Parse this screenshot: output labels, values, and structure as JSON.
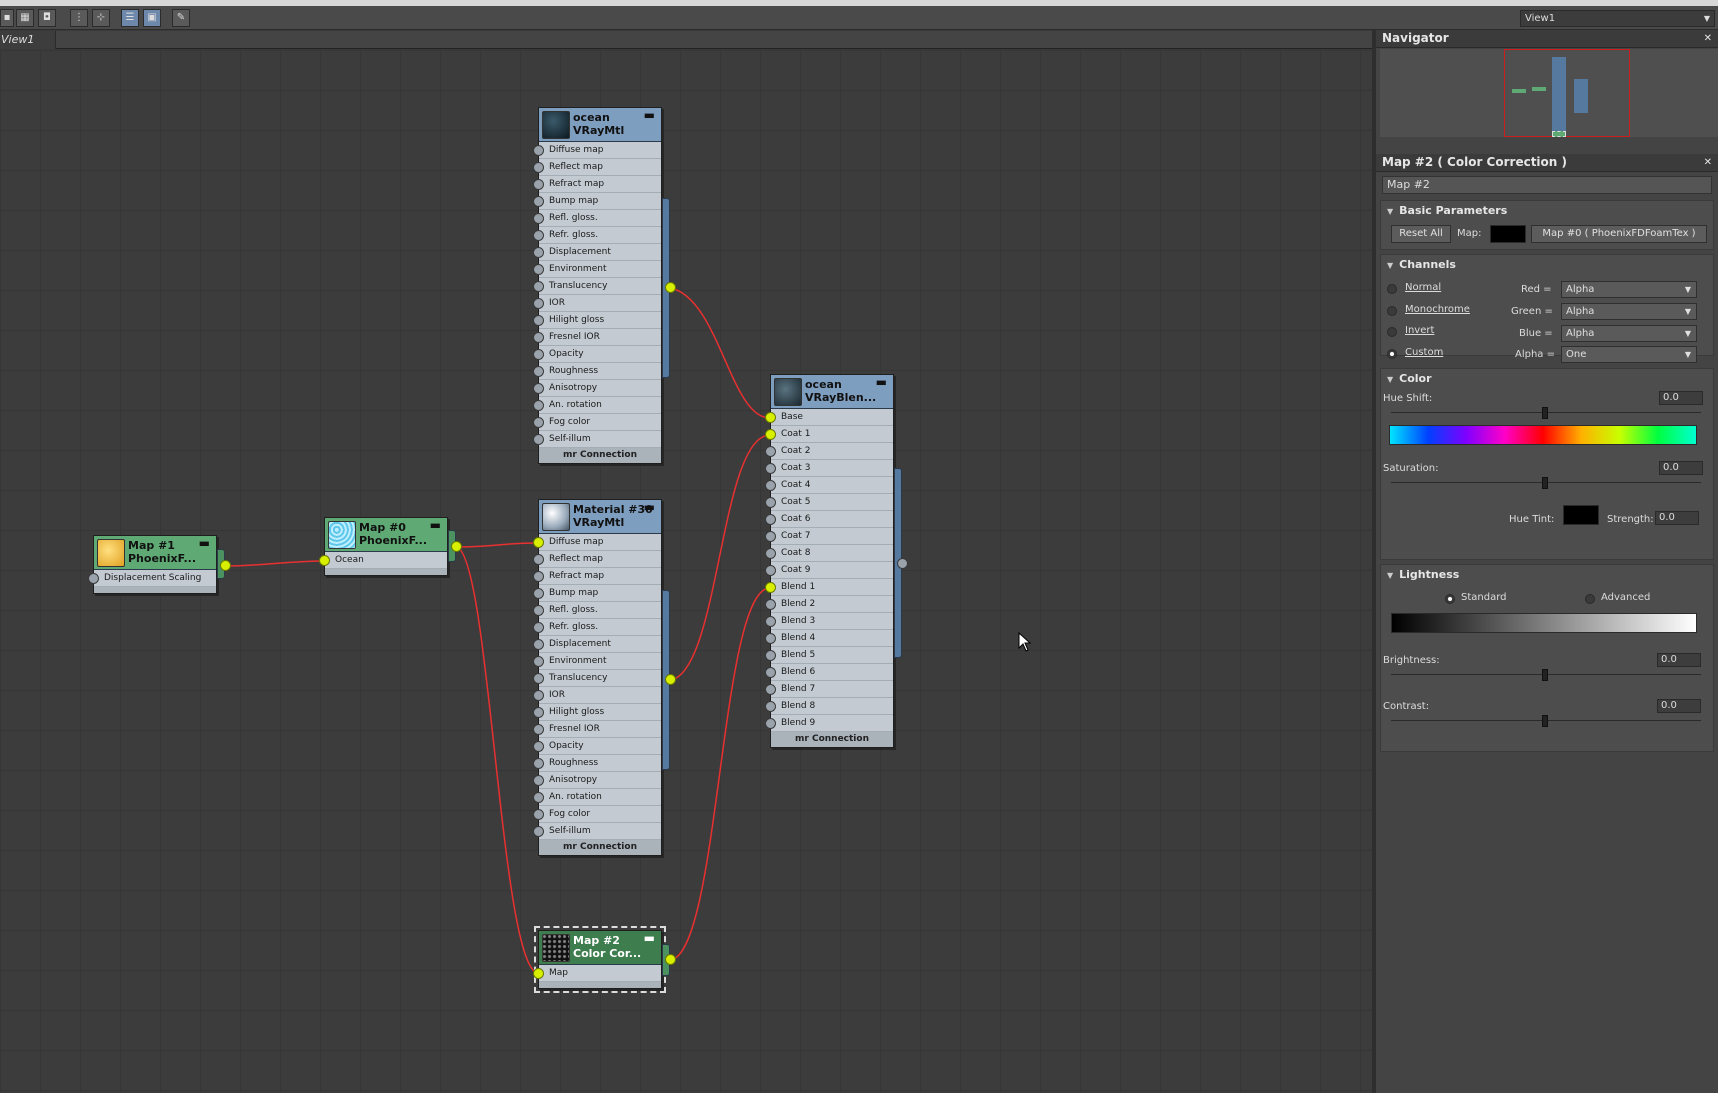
{
  "toolbar": {
    "view_select": "View1"
  },
  "tab": {
    "label": "View1"
  },
  "nodes": {
    "ocean_mtl": {
      "title1": "ocean",
      "title2": "VRayMtl",
      "slots": [
        "Diffuse map",
        "Reflect map",
        "Refract map",
        "Bump map",
        "Refl. gloss.",
        "Refr. gloss.",
        "Displacement",
        "Environment",
        "Translucency",
        "IOR",
        "Hilight gloss",
        "Fresnel IOR",
        "Opacity",
        "Roughness",
        "Anisotropy",
        "An. rotation",
        "Fog color",
        "Self-illum"
      ],
      "footer": "mr Connection"
    },
    "mat30": {
      "title1": "Material #30",
      "title2": "VRayMtl",
      "slots": [
        "Diffuse map",
        "Reflect map",
        "Refract map",
        "Bump map",
        "Refl. gloss.",
        "Refr. gloss.",
        "Displacement",
        "Environment",
        "Translucency",
        "IOR",
        "Hilight gloss",
        "Fresnel IOR",
        "Opacity",
        "Roughness",
        "Anisotropy",
        "An. rotation",
        "Fog color",
        "Self-illum"
      ],
      "footer": "mr Connection"
    },
    "ocean_blend": {
      "title1": "ocean",
      "title2": "VRayBlen...",
      "slots": [
        "Base",
        "Coat 1",
        "Coat 2",
        "Coat 3",
        "Coat 4",
        "Coat 5",
        "Coat 6",
        "Coat 7",
        "Coat 8",
        "Coat 9",
        "Blend 1",
        "Blend 2",
        "Blend 3",
        "Blend 4",
        "Blend 5",
        "Blend 6",
        "Blend 7",
        "Blend 8",
        "Blend 9"
      ],
      "footer": "mr Connection"
    },
    "map1": {
      "title1": "Map #1",
      "title2": "PhoenixF...",
      "slots": [
        "Displacement Scaling"
      ]
    },
    "map0": {
      "title1": "Map #0",
      "title2": "PhoenixF...",
      "slots": [
        "Ocean"
      ]
    },
    "map2": {
      "title1": "Map #2",
      "title2": "Color Cor...",
      "slots": [
        "Map"
      ]
    }
  },
  "navigator": {
    "title": "Navigator"
  },
  "params": {
    "title": "Map #2  ( Color Correction )",
    "name_value": "Map #2",
    "basic": {
      "header": "Basic Parameters",
      "reset": "Reset All",
      "map_label": "Map:",
      "map_button": "Map #0  ( PhoenixFDFoamTex )"
    },
    "channels": {
      "header": "Channels",
      "modes": [
        "Normal",
        "Monochrome",
        "Invert",
        "Custom"
      ],
      "selected_mode": "Custom",
      "red_label": "Red =",
      "red": "Alpha",
      "green_label": "Green =",
      "green": "Alpha",
      "blue_label": "Blue =",
      "blue": "Alpha",
      "alpha_label": "Alpha =",
      "alpha": "One"
    },
    "color": {
      "header": "Color",
      "hue_shift_label": "Hue Shift:",
      "hue_shift": "0.0",
      "saturation_label": "Saturation:",
      "saturation": "0.0",
      "hue_tint_label": "Hue Tint:",
      "strength_label": "Strength:",
      "strength": "0.0"
    },
    "lightness": {
      "header": "Lightness",
      "standard": "Standard",
      "advanced": "Advanced",
      "brightness_label": "Brightness:",
      "brightness": "0.0",
      "contrast_label": "Contrast:",
      "contrast": "0.0"
    }
  },
  "colors": {
    "wire": "#e83030",
    "socket_on": "#d8f000",
    "mtl_head": "#7e9ec0",
    "map_head": "#5faa74"
  }
}
